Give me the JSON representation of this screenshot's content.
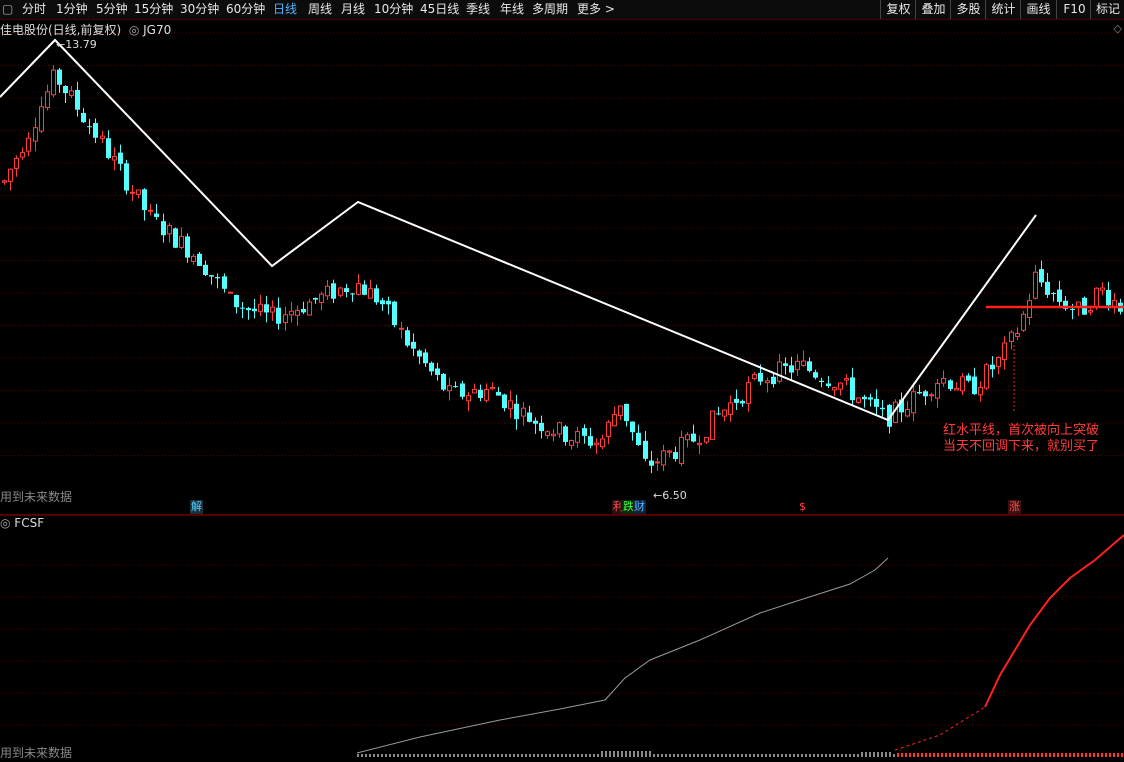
{
  "toolbar": {
    "periods": [
      {
        "label": "分时",
        "active": false
      },
      {
        "label": "1分钟",
        "active": false
      },
      {
        "label": "5分钟",
        "active": false
      },
      {
        "label": "15分钟",
        "active": false
      },
      {
        "label": "30分钟",
        "active": false
      },
      {
        "label": "60分钟",
        "active": false
      },
      {
        "label": "日线",
        "active": true
      },
      {
        "label": "周线",
        "active": false
      },
      {
        "label": "月线",
        "active": false
      },
      {
        "label": "10分钟",
        "active": false
      },
      {
        "label": "45日线",
        "active": false
      },
      {
        "label": "季线",
        "active": false
      },
      {
        "label": "年线",
        "active": false
      },
      {
        "label": "多周期",
        "active": false
      },
      {
        "label": "更多 >",
        "active": false
      }
    ],
    "right_buttons": [
      "复权",
      "叠加",
      "多股",
      "统计",
      "画线",
      "F10",
      "标记"
    ]
  },
  "main": {
    "stock_name": "佳电股份(日线,前复权)",
    "indicator": "JG70",
    "high_label": "13.79",
    "low_label": "6.50",
    "future_note": "用到未来数据",
    "annotation_line1": "红水平线，首次被向上突破",
    "annotation_line2": "当天不回调下来，就别买了",
    "markers": [
      {
        "text": "解",
        "color": "#4fd0ff",
        "bg": "#1b2f3a"
      },
      {
        "text": "利",
        "color": "#ff5050",
        "bg": "#2a1010"
      },
      {
        "text": "跌",
        "color": "#40ff40",
        "bg": "#102a10"
      },
      {
        "text": "财",
        "color": "#4fb4ff",
        "bg": "#10203a"
      },
      {
        "text": "$",
        "color": "#ff4040",
        "bg": "none"
      },
      {
        "text": "涨",
        "color": "#ff5050",
        "bg": "#3a1010"
      }
    ]
  },
  "sub": {
    "indicator": "FCSF",
    "future_note": "用到未来数据"
  },
  "colors": {
    "up": "#ff3c3c",
    "down": "#54ffff",
    "trend": "#ffffff",
    "grid": "#5a0000",
    "hline": "#ff2020"
  },
  "chart_data": {
    "type": "candlestick",
    "y_range": [
      6.2,
      14.3
    ],
    "hline_price": 9.5
  }
}
